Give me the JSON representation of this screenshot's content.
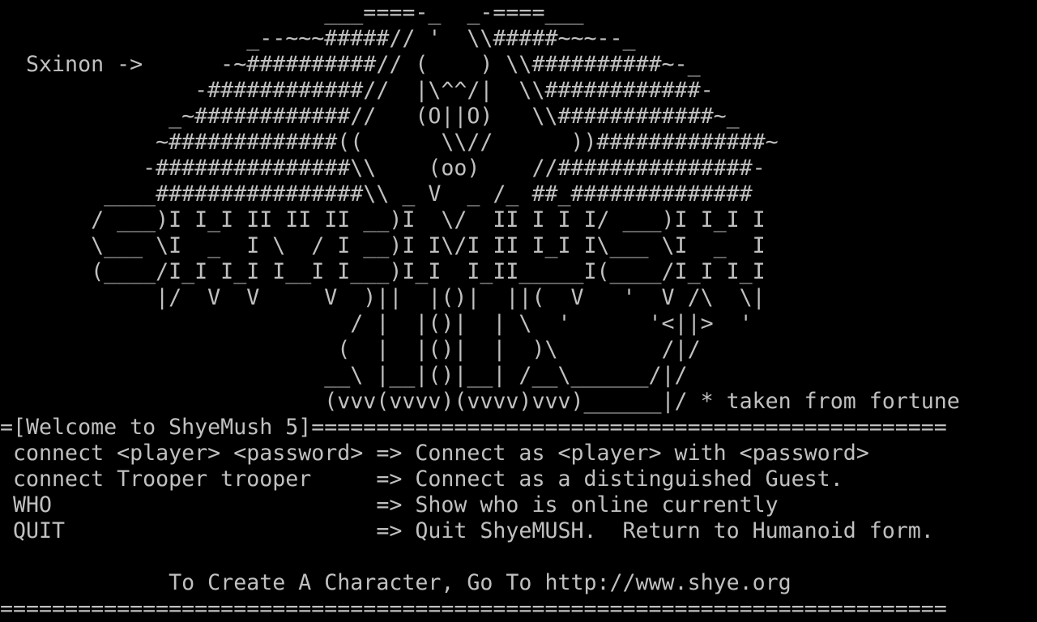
{
  "terminal": {
    "colors": {
      "background": "#000000",
      "foreground": "#c0c0c0"
    },
    "lines": [
      "                         ___====-_  _-====___",
      "                   _--~~~#####// '  \\\\#####~~~--_",
      "  Sxinon ->      -~##########// (    ) \\\\##########~-_",
      "               -############//  |\\^^/|  \\\\############-",
      "             _~############//   (O||O)   \\\\############~_",
      "            ~#############((      \\\\//      ))#############~",
      "           -###############\\\\    (oo)    //###############-",
      "        ____################\\\\ _ V  _ /_ ##_##############",
      "       / ___)I I_I II II II __)I  \\/  II I I I/ ___)I I_I I",
      "       \\___ \\I  _  I \\  / I __)I I\\/I II I_I I\\___ \\I  _  I",
      "       (____/I_I I_I I__I I___)I_I  I_II_____I(____/I_I I_I",
      "            |/  V  V     V  )||  |()|  ||(  V   '  V /\\  \\|",
      "                           / |  |()|  | \\  '      '<||>  '",
      "                          (  |  |()|  |  )\\        /|/",
      "                         __\\ |__|()|__| /__\\______/|/",
      "                         (vvv(vvvv)(vvvv)vvv)______|/ * taken from fortune",
      "=[Welcome to ShyeMush 5]=================================================",
      " connect <player> <password> => Connect as <player> with <password>",
      " connect Trooper trooper     => Connect as a distinguished Guest.",
      " WHO                         => Show who is online currently",
      " QUIT                        => Quit ShyeMUSH.  Return to Humanoid form.",
      "",
      "             To Create A Character, Go To http://www.shye.org",
      "========================================================================="
    ]
  }
}
